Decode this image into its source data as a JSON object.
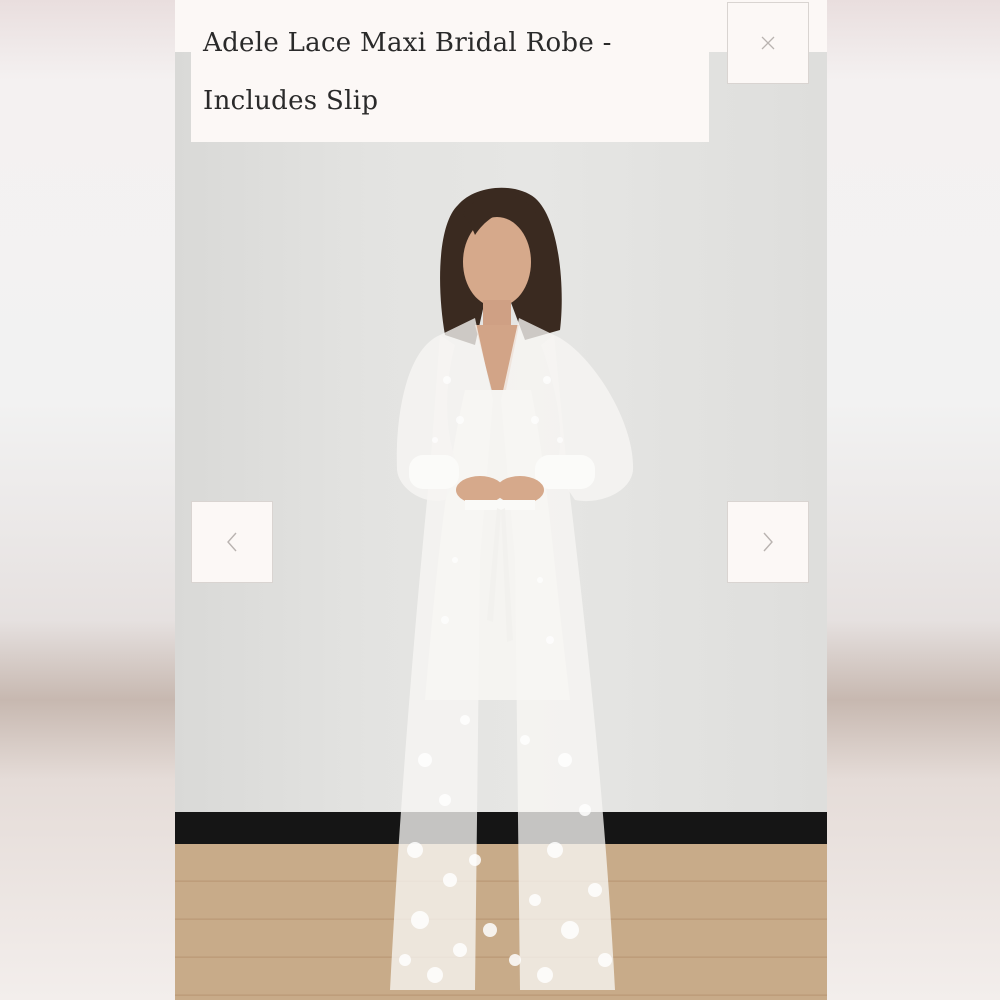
{
  "product": {
    "title_line1": "Adele Lace Maxi Bridal Robe -",
    "title_line2": "Includes Slip"
  },
  "controls": {
    "close_icon": "close-icon",
    "prev_icon": "chevron-left-icon",
    "next_icon": "chevron-right-icon"
  },
  "colors": {
    "panel": "#fcf8f6",
    "icon": "#b9b3b0",
    "text": "#2a2a2a"
  }
}
